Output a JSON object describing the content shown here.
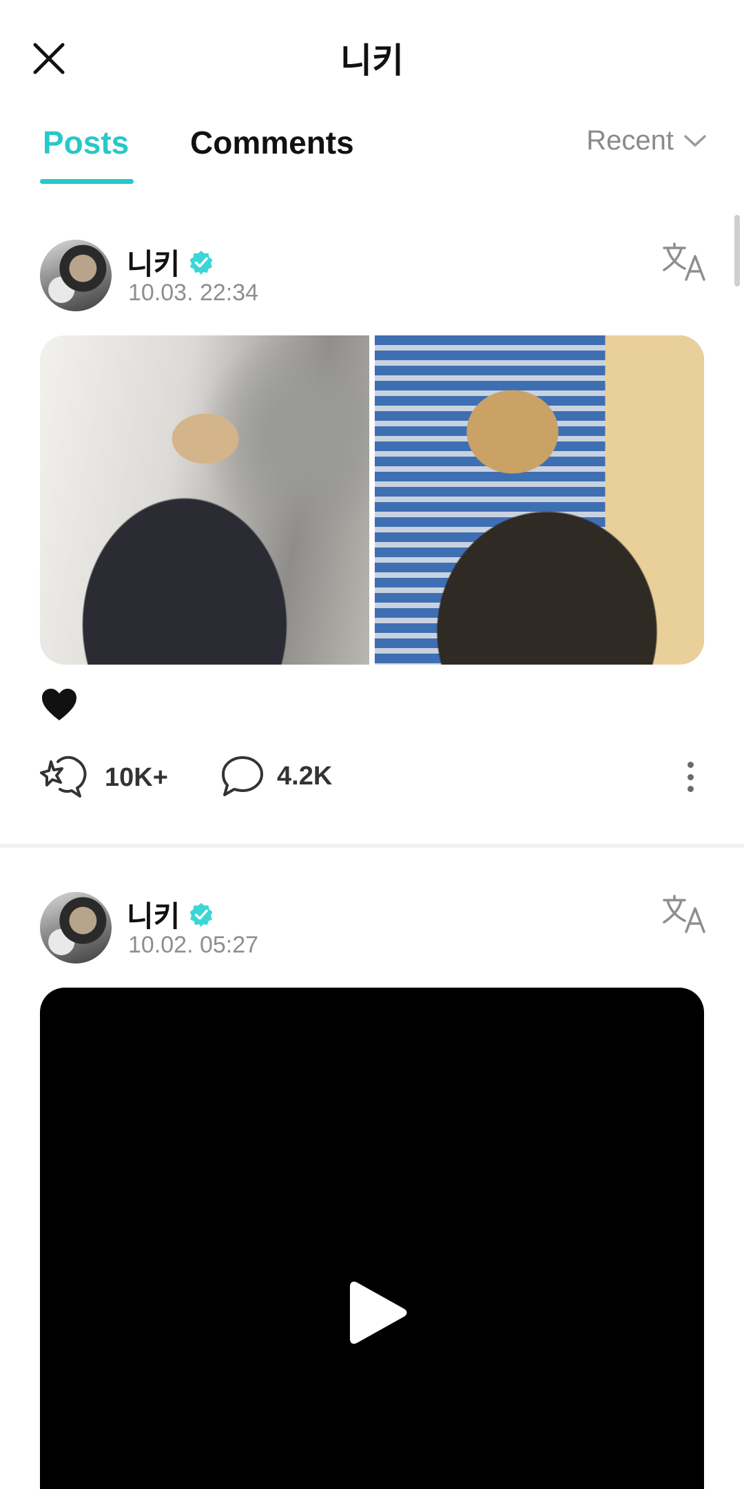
{
  "header": {
    "title": "니키",
    "close_icon": "close-icon"
  },
  "tabs": {
    "posts": "Posts",
    "comments": "Comments",
    "active": "Posts"
  },
  "sort": {
    "label": "Recent",
    "icon": "chevron-down-icon"
  },
  "colors": {
    "accent": "#27c8c8",
    "verified": "#3dd6d6",
    "muted": "#8e8e8e"
  },
  "posts": [
    {
      "author": "니키",
      "verified": true,
      "time": "10.03. 22:34",
      "media": "two-photo-gallery",
      "text_emoji": "🖤",
      "likes": "10K+",
      "comments": "4.2K"
    },
    {
      "author": "니키",
      "verified": true,
      "time": "10.02. 05:27",
      "media": "video"
    }
  ]
}
